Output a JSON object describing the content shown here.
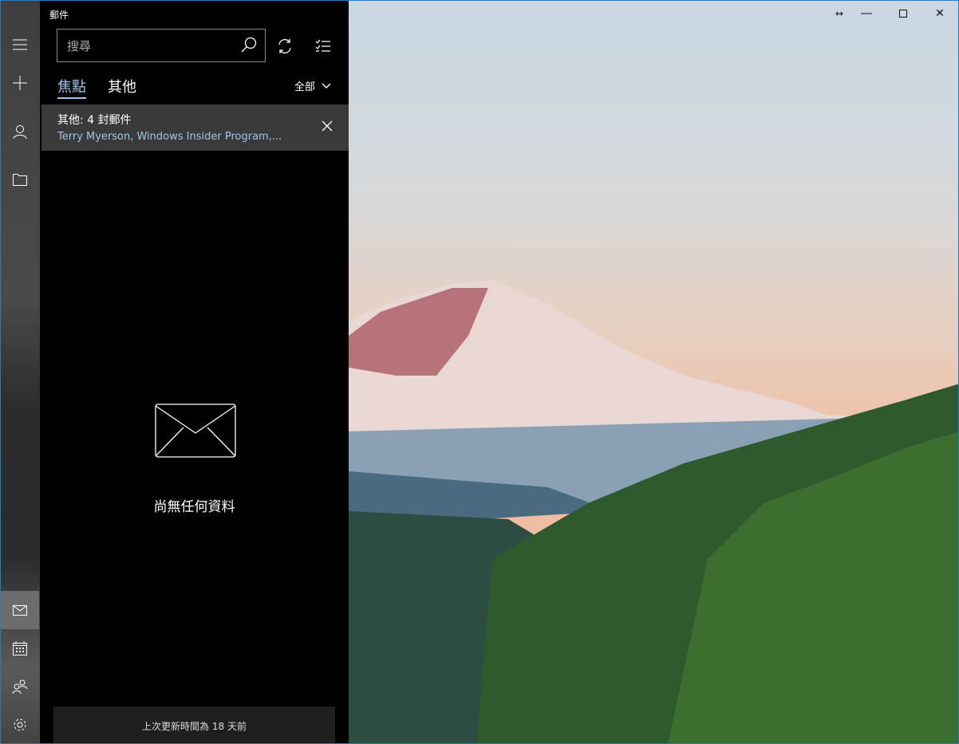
{
  "app": {
    "title": "郵件"
  },
  "search": {
    "placeholder": "搜尋"
  },
  "tabs": [
    {
      "label": "焦點",
      "selected": true
    },
    {
      "label": "其他",
      "selected": false
    }
  ],
  "filter": {
    "label": "全部"
  },
  "banner": {
    "title": "其他: 4 封郵件",
    "senders": "Terry Myerson, Windows Insider Program,..."
  },
  "empty": {
    "text": "尚無任何資料"
  },
  "footer": {
    "status": "上次更新時間為 18 天前"
  },
  "colors": {
    "accent": "#9fc6ea",
    "border": "#2b79c4"
  }
}
